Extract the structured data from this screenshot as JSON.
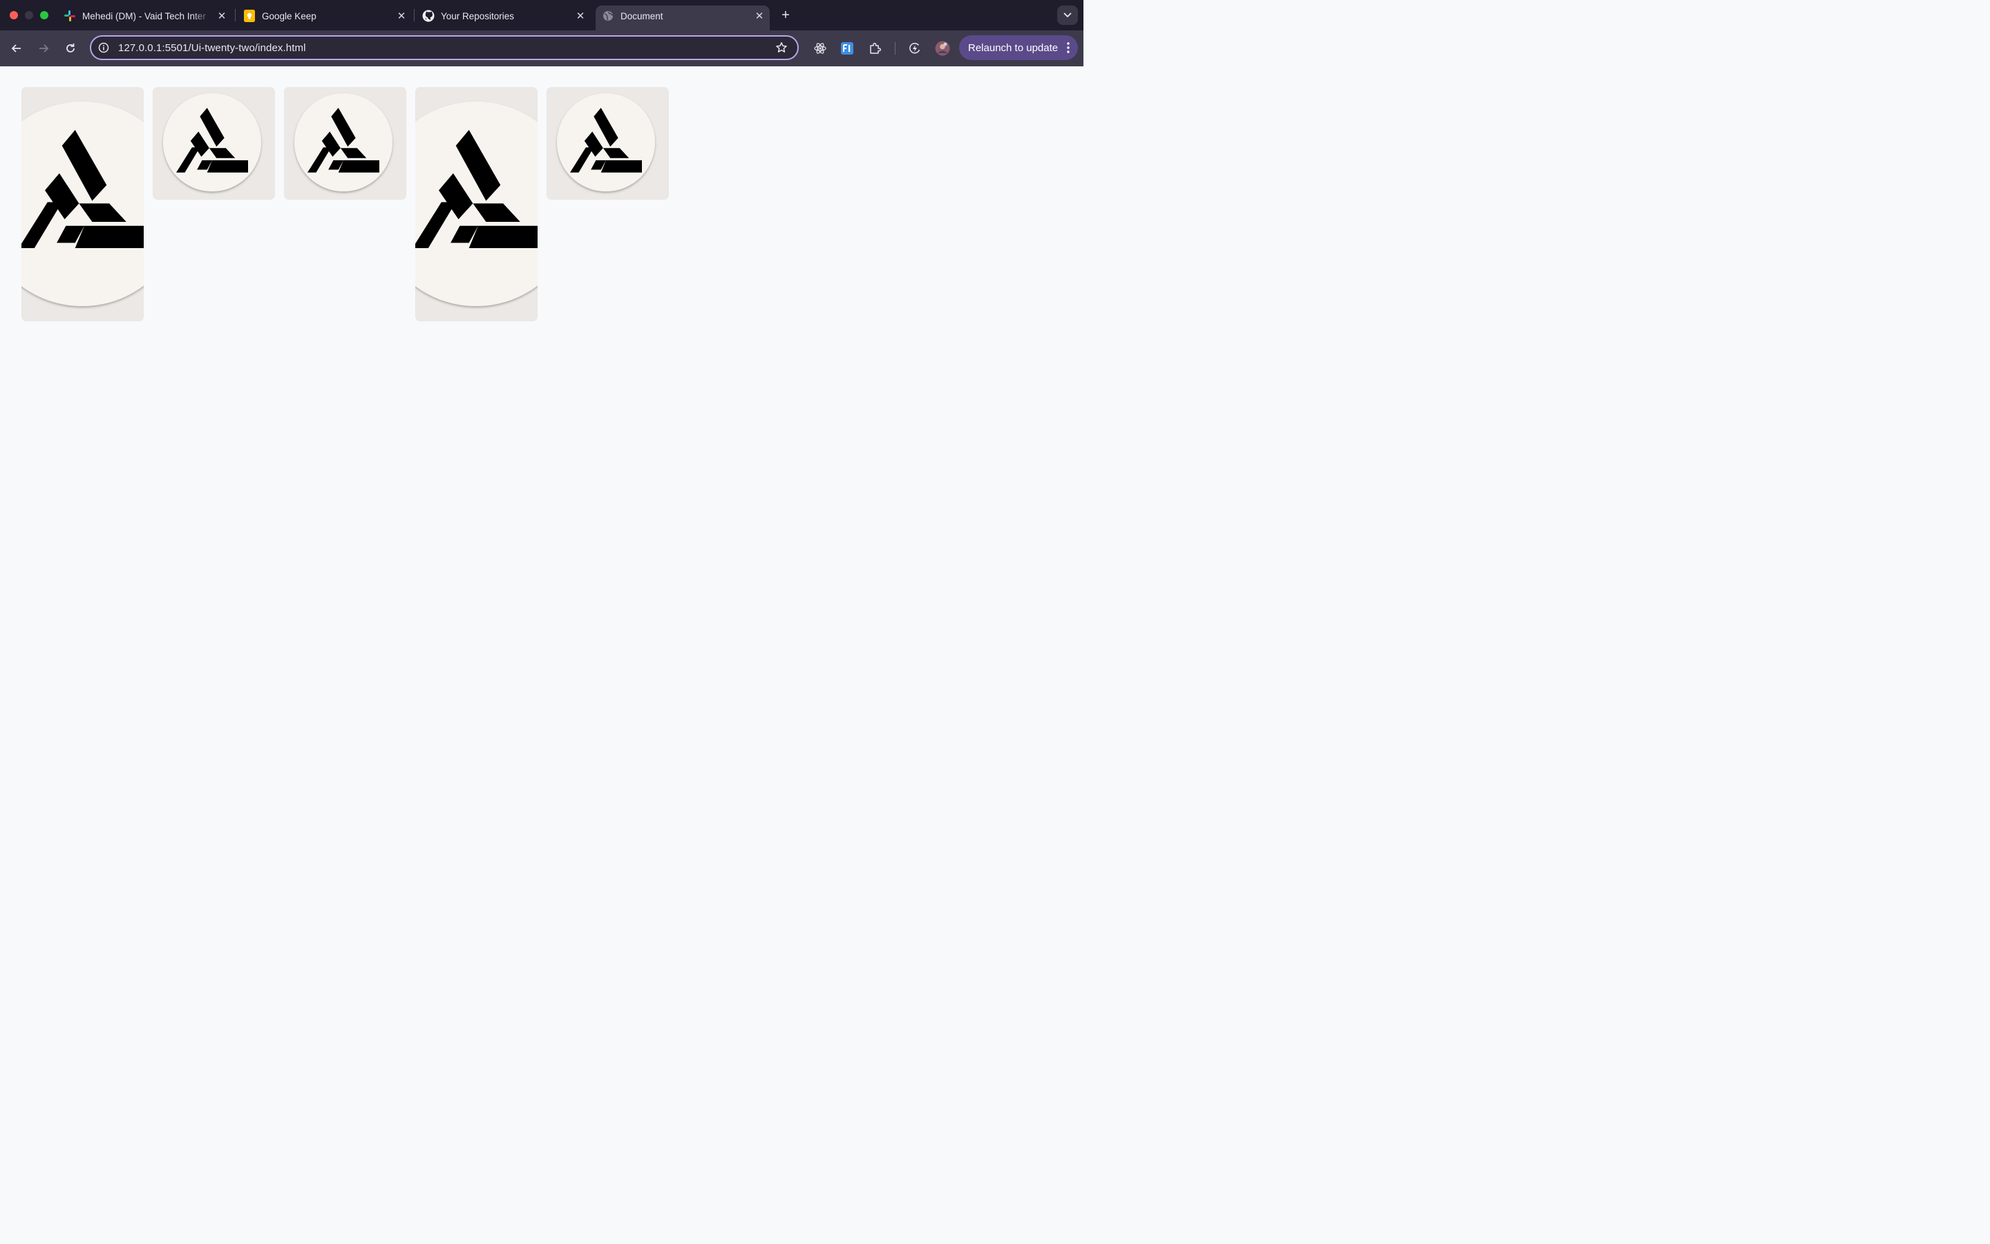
{
  "browser": {
    "tabs": [
      {
        "title": "Mehedi (DM) - Vaid Tech Inter",
        "icon": "slack-icon",
        "active": false
      },
      {
        "title": "Google Keep",
        "icon": "google-keep-icon",
        "active": false
      },
      {
        "title": "Your Repositories",
        "icon": "github-icon",
        "active": false
      },
      {
        "title": "Document",
        "icon": "globe-icon",
        "active": true
      }
    ],
    "address_bar": {
      "url": "127.0.0.1:5501/Ui-twenty-two/index.html"
    },
    "relaunch_label": "Relaunch to update",
    "extensions": [
      "react-devtools-icon",
      "fi-extension-icon",
      "extensions-puzzle-icon",
      "performance-icon",
      "profile-avatar"
    ]
  },
  "page": {
    "cards": [
      {
        "size": "tall",
        "image": "atlas-triangle-logo"
      },
      {
        "size": "small",
        "image": "atlas-triangle-logo"
      },
      {
        "size": "small",
        "image": "atlas-triangle-logo"
      },
      {
        "size": "tall",
        "image": "atlas-triangle-logo"
      },
      {
        "size": "small",
        "image": "atlas-triangle-logo"
      }
    ]
  },
  "colors": {
    "titlebar": "#1f1c2c",
    "toolbar": "#3d3a4c",
    "omnibox_border": "#b9a6e8",
    "relaunch_button": "#5a4a8a",
    "page_background": "#f8f9fb",
    "card_background": "#ebe8e5",
    "logo_disc": "#f7f4f0"
  }
}
